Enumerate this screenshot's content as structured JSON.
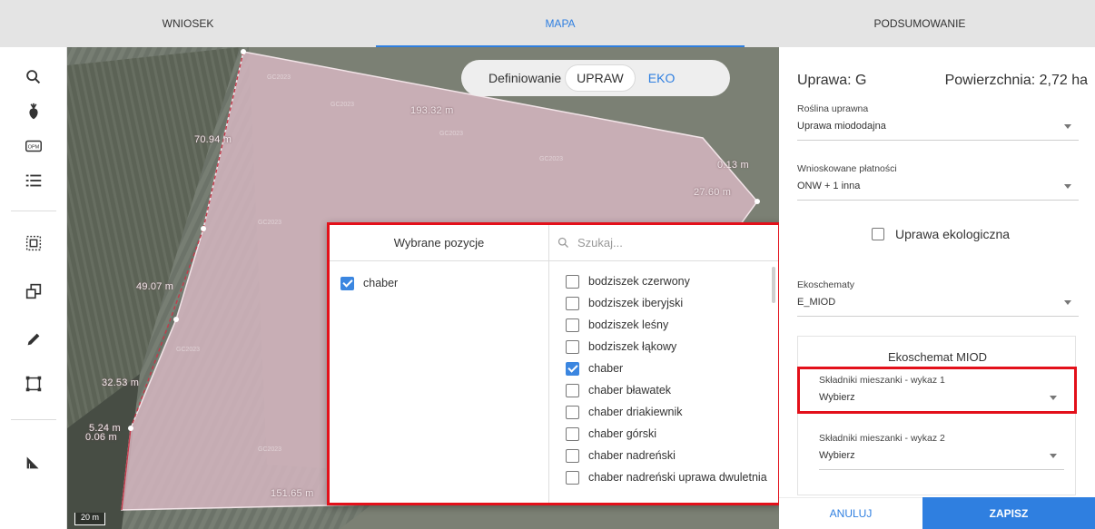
{
  "tabs": [
    {
      "label": "WNIOSEK"
    },
    {
      "label": "MAPA"
    },
    {
      "label": "PODSUMOWANIE"
    }
  ],
  "toolbar": {
    "icons": [
      "search-icon",
      "plant-icon",
      "opm-icon",
      "list-icon",
      "select-area-icon",
      "copy-icon",
      "edit-icon",
      "bounding-box-icon",
      "measure-angle-icon"
    ],
    "opm_text": "OPM"
  },
  "map": {
    "mode_label": "Definiowanie",
    "mode_active": "UPRAW",
    "mode_other": "EKO",
    "measurements": [
      "193.32 m",
      "70.94 m",
      "0.13 m",
      "27.60 m",
      "49.07 m",
      "32.53 m",
      "5.24 m",
      "0.06 m",
      "151.65 m"
    ],
    "watermark": "GC2023",
    "scale": "20 m"
  },
  "picker": {
    "selected_header": "Wybrane pozycje",
    "search_placeholder": "Szukaj...",
    "selected": [
      {
        "label": "chaber",
        "checked": true
      }
    ],
    "options": [
      {
        "label": "bodziszek czerwony",
        "checked": false
      },
      {
        "label": "bodziszek iberyjski",
        "checked": false
      },
      {
        "label": "bodziszek leśny",
        "checked": false
      },
      {
        "label": "bodziszek łąkowy",
        "checked": false
      },
      {
        "label": "chaber",
        "checked": true
      },
      {
        "label": "chaber bławatek",
        "checked": false
      },
      {
        "label": "chaber driakiewnik",
        "checked": false
      },
      {
        "label": "chaber górski",
        "checked": false
      },
      {
        "label": "chaber nadreński",
        "checked": false
      },
      {
        "label": "chaber nadreński uprawa dwuletnia",
        "checked": false
      }
    ]
  },
  "panel": {
    "title": "Uprawa: G",
    "area": "Powierzchnia: 2,72 ha",
    "crop_label": "Roślina uprawna",
    "crop_value": "Uprawa miododajna",
    "payments_label": "Wnioskowane płatności",
    "payments_value": "ONW + 1 inna",
    "organic_label": "Uprawa ekologiczna",
    "eco_label": "Ekoschematy",
    "eco_value": "E_MIOD",
    "box_title": "Ekoschemat MIOD",
    "mix1_label": "Składniki mieszanki - wykaz 1",
    "mix1_value": "Wybierz",
    "mix2_label": "Składniki mieszanki - wykaz 2",
    "mix2_value": "Wybierz",
    "cancel": "ANULUJ",
    "save": "ZAPISZ"
  },
  "colors": {
    "accent": "#2f7fe0",
    "highlight": "#e3101a"
  }
}
